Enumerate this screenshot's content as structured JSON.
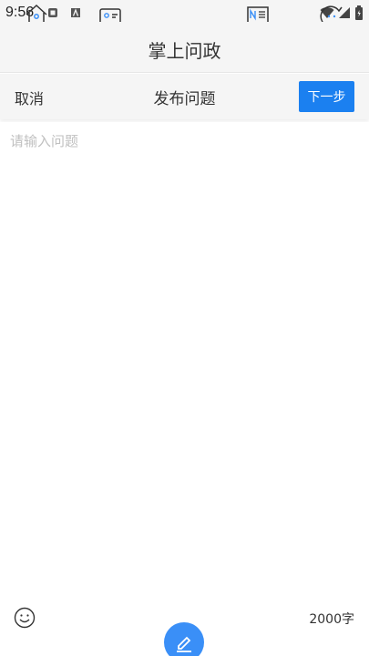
{
  "status_bar": {
    "time": "9:56",
    "icons": [
      "app-notification-icon",
      "text-app-icon",
      "wifi-icon",
      "signal-icon",
      "battery-icon"
    ]
  },
  "header": {
    "title": "掌上问政"
  },
  "compose_bar": {
    "cancel_label": "取消",
    "title": "发布问题",
    "next_label": "下一步"
  },
  "editor": {
    "placeholder": "请输入问题",
    "value": ""
  },
  "footer": {
    "emoji_icon": "smiley-icon",
    "char_limit": "2000字"
  },
  "tabbar": {
    "icons": [
      "home-icon",
      "id-card-icon",
      "edit-icon",
      "news-icon",
      "chat-icon"
    ]
  },
  "colors": {
    "accent": "#1b80f0",
    "fab": "#3a8ff7",
    "header_bg": "#f5f5f5",
    "placeholder": "#c0c0c0"
  }
}
